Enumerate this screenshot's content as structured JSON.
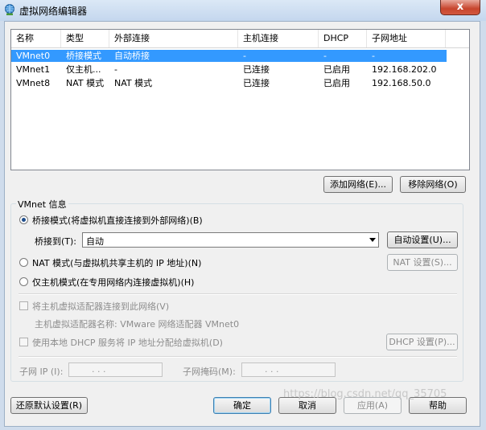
{
  "window": {
    "title": "虚拟网络编辑器",
    "close_label": "x"
  },
  "table": {
    "columns": [
      "名称",
      "类型",
      "外部连接",
      "主机连接",
      "DHCP",
      "子网地址"
    ],
    "rows": [
      {
        "name": "VMnet0",
        "type": "桥接模式",
        "external": "自动桥接",
        "host": "-",
        "dhcp": "-",
        "subnet": "-",
        "selected": true
      },
      {
        "name": "VMnet1",
        "type": "仅主机...",
        "external": "-",
        "host": "已连接",
        "dhcp": "已启用",
        "subnet": "192.168.202.0",
        "selected": false
      },
      {
        "name": "VMnet8",
        "type": "NAT 模式",
        "external": "NAT 模式",
        "host": "已连接",
        "dhcp": "已启用",
        "subnet": "192.168.50.0",
        "selected": false
      }
    ]
  },
  "buttons": {
    "add_network": "添加网络(E)...",
    "remove_network": "移除网络(O)",
    "auto_settings": "自动设置(U)...",
    "nat_settings": "NAT 设置(S)...",
    "dhcp_settings": "DHCP 设置(P)...",
    "restore_defaults": "还原默认设置(R)",
    "ok": "确定",
    "cancel": "取消",
    "apply": "应用(A)",
    "help": "帮助"
  },
  "vmnet_info": {
    "group_label": "VMnet 信息",
    "bridged_label": "桥接模式(将虚拟机直接连接到外部网络)(B)",
    "bridge_to_label": "桥接到(T):",
    "bridge_to_value": "自动",
    "nat_label": "NAT 模式(与虚拟机共享主机的 IP 地址)(N)",
    "hostonly_label": "仅主机模式(在专用网络内连接虚拟机)(H)",
    "connect_adapter_label": "将主机虚拟适配器连接到此网络(V)",
    "adapter_name_label": "主机虚拟适配器名称: VMware 网络适配器 VMnet0",
    "use_dhcp_label": "使用本地 DHCP 服务将 IP 地址分配给虚拟机(D)",
    "subnet_ip_label": "子网 IP (I):",
    "subnet_mask_label": "子网掩码(M):",
    "ip_dots": ".   .   .",
    "mode_selected": "bridged"
  },
  "watermark": "https://blog.csdn.net/qq_35705"
}
